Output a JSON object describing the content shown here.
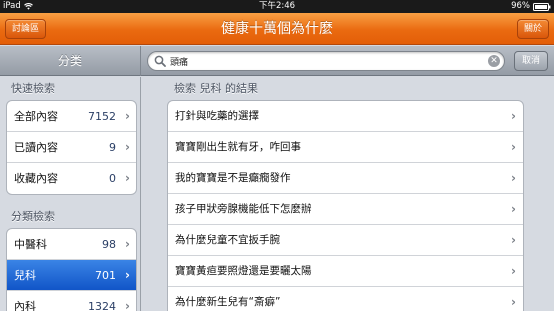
{
  "status_bar": {
    "device": "iPad",
    "time": "下午2:46",
    "battery": "96%"
  },
  "header": {
    "title": "健康十萬個為什麼",
    "left_button": "討論區",
    "right_button": "關於"
  },
  "toolbar": {
    "category_title": "分类",
    "search_value": "頭痛",
    "cancel_label": "取消"
  },
  "sidebar": {
    "quick_header": "快速檢索",
    "quick_items": [
      {
        "label": "全部內容",
        "count": "7152"
      },
      {
        "label": "已讀內容",
        "count": "9"
      },
      {
        "label": "收藏內容",
        "count": "0"
      }
    ],
    "category_header": "分類檢索",
    "category_items": [
      {
        "label": "中醫科",
        "count": "98",
        "selected": false
      },
      {
        "label": "兒科",
        "count": "701",
        "selected": true
      },
      {
        "label": "內科",
        "count": "1324",
        "selected": false
      }
    ]
  },
  "results": {
    "header": "檢索 兒科 的結果",
    "items": [
      "打針與吃藥的選擇",
      "寶寶剛出生就有牙，咋回事",
      "我的寶寶是不是癲癇發作",
      "孩子甲狀旁腺機能低下怎麼辦",
      "為什麼兒童不宜扳手腕",
      "寶寶黃疸要照燈還是要曬太陽",
      "為什麼新生兒有“斎癖”"
    ]
  },
  "colors": {
    "header_orange": "#ea6a10",
    "selected_blue": "#1a62d6",
    "background_grey": "#d6dae1"
  },
  "icons": {
    "search": "magnifier-icon",
    "clear": "clear-x-icon",
    "chevron": "chevron-right-icon",
    "wifi": "wifi-icon",
    "battery": "battery-icon"
  }
}
